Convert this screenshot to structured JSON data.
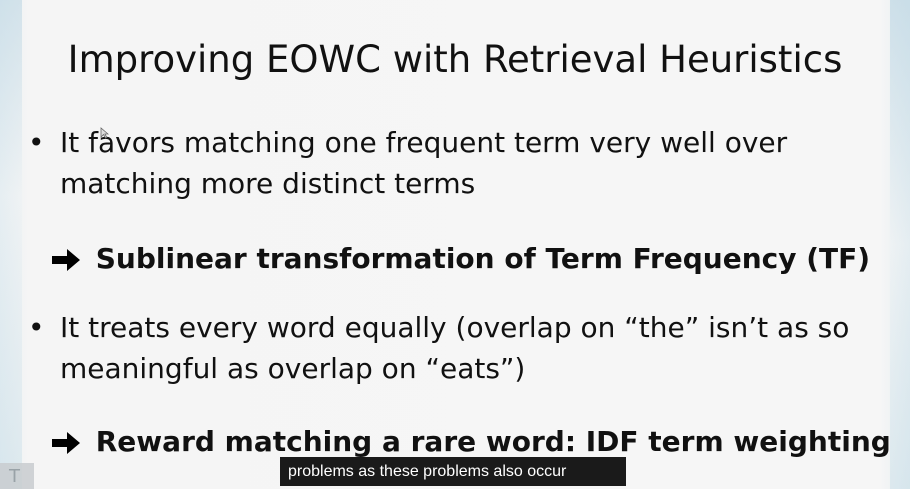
{
  "slide": {
    "title": "Improving EOWC with Retrieval Heuristics",
    "bullets": [
      {
        "dot": "•",
        "text": "It favors matching one frequent term very well over matching more distinct terms"
      },
      {
        "dot": "•",
        "text": "It treats every word equally (overlap on “the” isn’t as so meaningful as overlap on “eats”)"
      }
    ],
    "conclusions": [
      "Sublinear transformation of Term Frequency (TF)",
      "Reward matching a rare word:  IDF term weighting"
    ]
  },
  "subtitle": {
    "text": "problems as these problems also occur"
  },
  "icons": {
    "arrow": "right-arrow-icon",
    "cursor": "mouse-cursor-icon",
    "logo": "player-logo-icon"
  }
}
